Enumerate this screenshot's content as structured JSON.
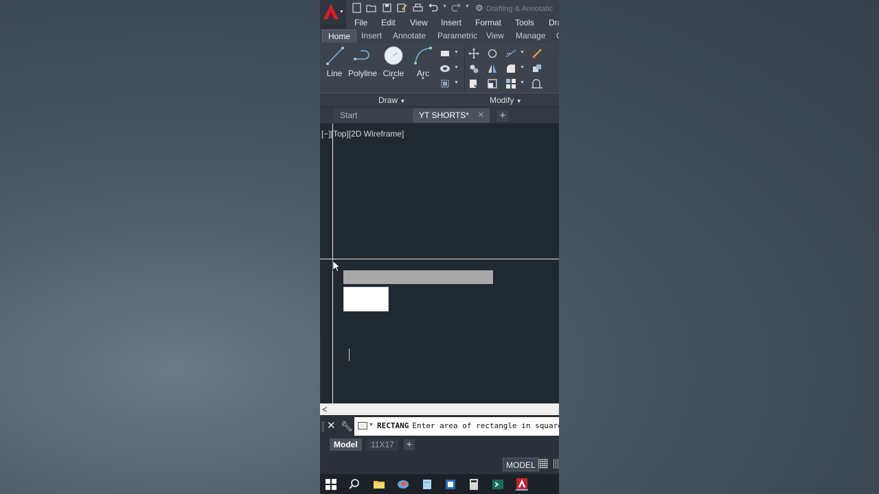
{
  "window": {
    "workspace_label": "Drafting & Annotatic"
  },
  "menu": [
    "File",
    "Edit",
    "View",
    "Insert",
    "Format",
    "Tools",
    "Dra"
  ],
  "ribbon_tabs": [
    "Home",
    "Insert",
    "Annotate",
    "Parametric",
    "View",
    "Manage",
    "C"
  ],
  "draw_tools": [
    "Line",
    "Polyline",
    "Circle",
    "Arc"
  ],
  "panels": {
    "draw": "Draw",
    "modify": "Modify"
  },
  "file_tabs": {
    "start": "Start",
    "active": "YT SHORTS*",
    "close_glyph": "✕",
    "add_glyph": "+"
  },
  "viewport": {
    "label": "[−][Top][2D Wireframe]"
  },
  "scroll": {
    "left_arrow": "<"
  },
  "command_line": {
    "command": "RECTANG",
    "prompt": "Enter area of rectangle in square"
  },
  "layout_tabs": {
    "model": "Model",
    "layout": "11X17",
    "add": "+"
  },
  "status": {
    "model_space": "MODEL"
  },
  "colors": {
    "canvas": "#212930",
    "ribbon": "#3c434d",
    "accent_logo": "#d0212a"
  },
  "taskbar_icons": [
    "windows-start-icon",
    "search-icon",
    "file-explorer-icon",
    "browser-icon",
    "notes-icon",
    "app-icon",
    "calculator-icon",
    "terminal-icon",
    "autocad-icon"
  ]
}
